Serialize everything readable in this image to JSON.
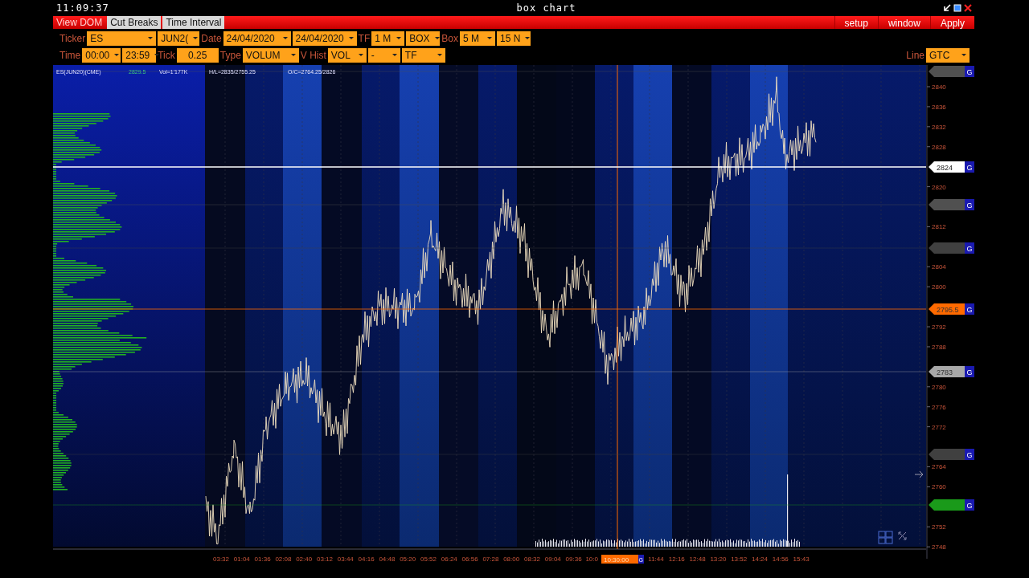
{
  "window": {
    "clock": "11:09:37",
    "title": "box chart"
  },
  "menu": [
    {
      "label": "View DOM",
      "selected": true
    },
    {
      "label": "Cut Breaks",
      "selected": false
    },
    {
      "label": "Time Interval",
      "selected": false
    }
  ],
  "actions": [
    "setup",
    "window",
    "Apply"
  ],
  "toolbar_rows": [
    [
      {
        "kind": "label",
        "text": "Ticker"
      },
      {
        "kind": "select",
        "value": "ES"
      },
      {
        "kind": "select",
        "value": "JUN2("
      },
      {
        "kind": "label",
        "text": "Date"
      },
      {
        "kind": "select",
        "value": "24/04/2020"
      },
      {
        "kind": "select",
        "value": "24/04/2020"
      },
      {
        "kind": "label",
        "text": "TF"
      },
      {
        "kind": "select",
        "value": "1 M"
      },
      {
        "kind": "select",
        "value": "BOX"
      },
      {
        "kind": "label",
        "text": "Box"
      },
      {
        "kind": "select",
        "value": "5 M"
      },
      {
        "kind": "select",
        "value": "15 N"
      }
    ],
    [
      {
        "kind": "label",
        "text": "Time"
      },
      {
        "kind": "select",
        "value": "00:00"
      },
      {
        "kind": "select",
        "value": "23:59"
      },
      {
        "kind": "label",
        "text": "Tick"
      },
      {
        "kind": "input",
        "value": "0.25"
      },
      {
        "kind": "label",
        "text": "Type"
      },
      {
        "kind": "select",
        "value": "VOLUM"
      },
      {
        "kind": "label",
        "text": "V Hist"
      },
      {
        "kind": "select",
        "value": "VOL"
      },
      {
        "kind": "select",
        "value": "-"
      },
      {
        "kind": "select",
        "value": "TF"
      }
    ]
  ],
  "line_control": {
    "label": "Line",
    "value": "GTC"
  },
  "chart": {
    "info": [
      {
        "text": "ES(JUN20)(CME)",
        "kind": "text"
      },
      {
        "text": "2829.5",
        "kind": "price"
      },
      {
        "text": "Vol=1'177K",
        "kind": "text"
      },
      {
        "text": "H/L=2835/2755.25",
        "kind": "text"
      },
      {
        "text": "O/C=2764.25/2826",
        "kind": "text"
      }
    ],
    "y_axis": [
      "2840",
      "2836",
      "2832",
      "2828",
      "2820",
      "2812",
      "2804",
      "2800",
      "2792",
      "2788",
      "2780",
      "2776",
      "2772",
      "2764",
      "2760",
      "2752",
      "2748"
    ],
    "price_tags": [
      {
        "color": "#505050",
        "button": "G"
      },
      {
        "label": "2824",
        "color": "#ffffff",
        "button": "G"
      },
      {
        "color": "#505050",
        "button": "G"
      },
      {
        "color": "#404040",
        "button": "G"
      },
      {
        "label": "2795.5",
        "color": "#ff6a00",
        "button": "G"
      },
      {
        "label": "2783",
        "color": "#a8a8a8",
        "button": "G"
      },
      {
        "color": "#404040",
        "button": "G"
      },
      {
        "color": "#1a9a1a",
        "button": "G"
      }
    ],
    "x_axis": [
      "03:32",
      "01:04",
      "01:36",
      "02:08",
      "02:40",
      "03:12",
      "03:44",
      "04:16",
      "04:48",
      "05:20",
      "05:52",
      "06:24",
      "06:56",
      "07:28",
      "08:00",
      "08:32",
      "09:04",
      "09:36",
      "10:0",
      "11:44",
      "12:16",
      "12:48",
      "13:20",
      "13:52",
      "14:24",
      "14:56",
      "15:43"
    ],
    "cursor": {
      "time": "10:30:00",
      "button": "G"
    }
  }
}
